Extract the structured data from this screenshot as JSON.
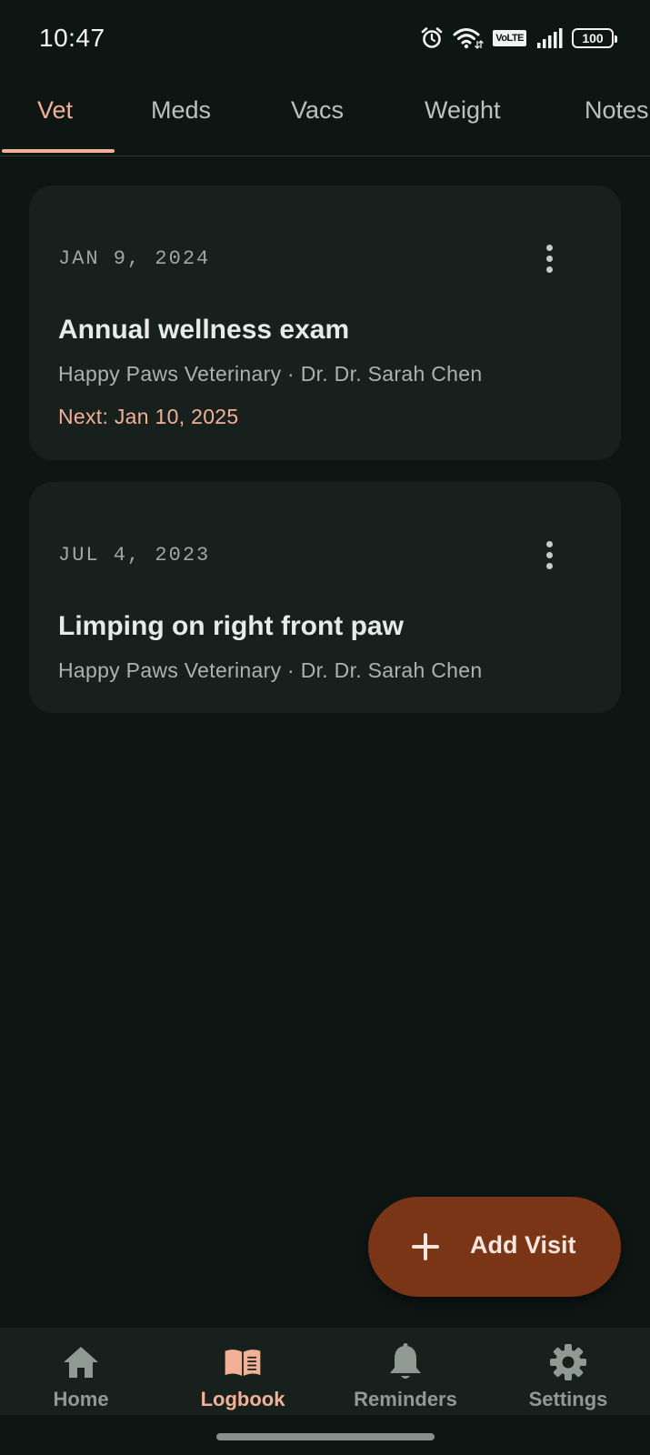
{
  "status_bar": {
    "time": "10:47",
    "network_label": "VoLTE",
    "battery": "100"
  },
  "tabs": [
    {
      "label": "Vet",
      "active": true
    },
    {
      "label": "Meds",
      "active": false
    },
    {
      "label": "Vacs",
      "active": false
    },
    {
      "label": "Weight",
      "active": false
    },
    {
      "label": "Notes",
      "active": false
    }
  ],
  "visits": [
    {
      "date": "JAN 9, 2024",
      "title": "Annual wellness exam",
      "subtitle": "Happy Paws Veterinary · Dr. Dr. Sarah Chen",
      "next": "Next: Jan 10, 2025"
    },
    {
      "date": "JUL 4, 2023",
      "title": "Limping on right front paw",
      "subtitle": "Happy Paws Veterinary · Dr. Dr. Sarah Chen"
    }
  ],
  "fab": {
    "label": "Add Visit",
    "icon": "plus-icon"
  },
  "bottom_nav": [
    {
      "label": "Home",
      "icon": "home-icon",
      "active": false
    },
    {
      "label": "Logbook",
      "icon": "book-icon",
      "active": true
    },
    {
      "label": "Reminders",
      "icon": "bell-icon",
      "active": false
    },
    {
      "label": "Settings",
      "icon": "gear-icon",
      "active": false
    }
  ],
  "colors": {
    "background": "#0e1614",
    "card": "#18201e",
    "accent": "#f2b096",
    "fab": "#7a3416",
    "inactive": "#8f9a95"
  }
}
